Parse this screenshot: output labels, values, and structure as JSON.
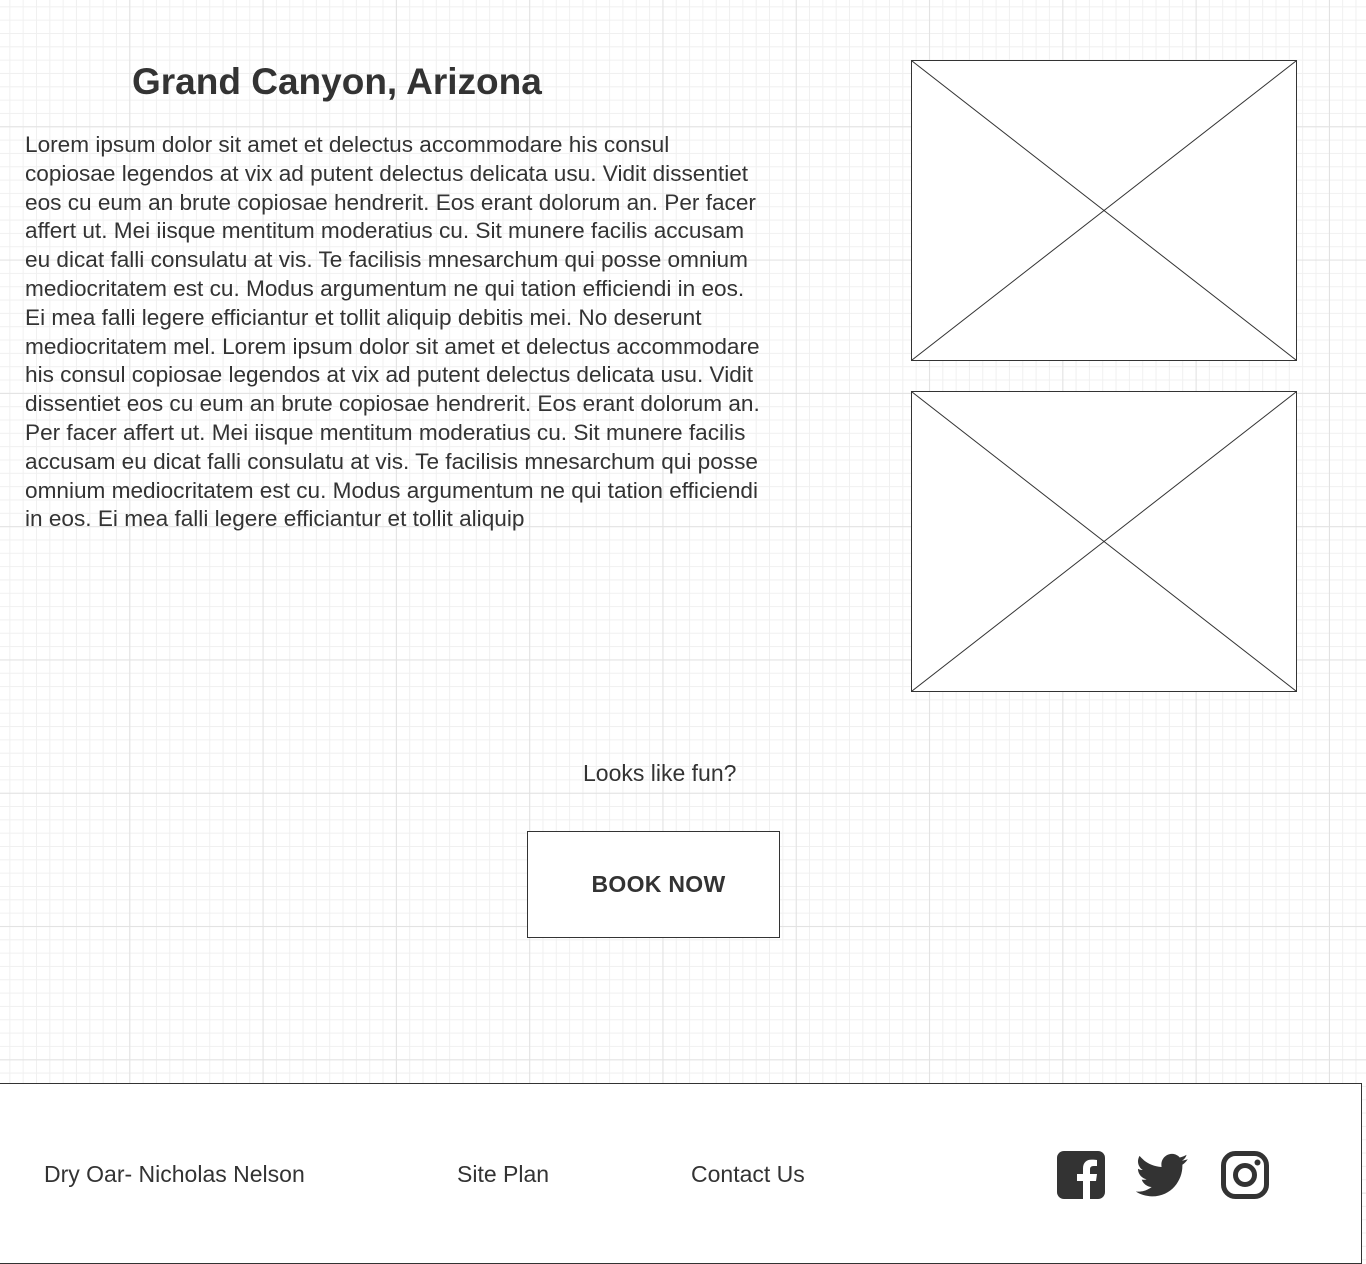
{
  "main": {
    "title": "Grand Canyon, Arizona",
    "body": "Lorem ipsum dolor sit amet et delectus accommodare his consul copiosae legendos at vix ad putent delectus delicata usu. Vidit dissentiet eos cu eum an brute copiosae hendrerit. Eos erant dolorum an. Per facer affert ut. Mei iisque mentitum moderatius cu. Sit munere facilis accusam eu dicat falli consulatu at vis. Te facilisis mnesarchum qui posse omnium mediocritatem est cu. Modus argumentum ne qui tation efficiendi in eos. Ei mea falli legere efficiantur et tollit aliquip debitis mei. No deserunt mediocritatem mel. Lorem ipsum dolor sit amet et delectus accommodare his consul copiosae legendos at vix ad putent delectus delicata usu. Vidit dissentiet eos cu eum an brute copiosae hendrerit. Eos erant dolorum an. Per facer affert ut. Mei iisque mentitum moderatius cu. Sit munere facilis accusam eu dicat falli consulatu at vis. Te facilisis mnesarchum qui posse omnium mediocritatem est cu. Modus argumentum ne qui tation efficiendi in eos. Ei mea falli legere efficiantur et tollit aliquip",
    "tagline": "Looks like fun?",
    "book_label": "BOOK NOW"
  },
  "images": [
    {
      "icon": "image-placeholder-icon"
    },
    {
      "icon": "image-placeholder-icon"
    }
  ],
  "footer": {
    "owner": "Dry Oar- Nicholas Nelson",
    "site_plan": "Site Plan",
    "contact": "Contact Us",
    "social": [
      "facebook-icon",
      "twitter-icon",
      "instagram-icon"
    ]
  },
  "colors": {
    "text": "#333333",
    "border": "#333333",
    "grid_major": "#e2e2e2",
    "grid_minor": "#f0f0f0",
    "background": "#ffffff"
  }
}
